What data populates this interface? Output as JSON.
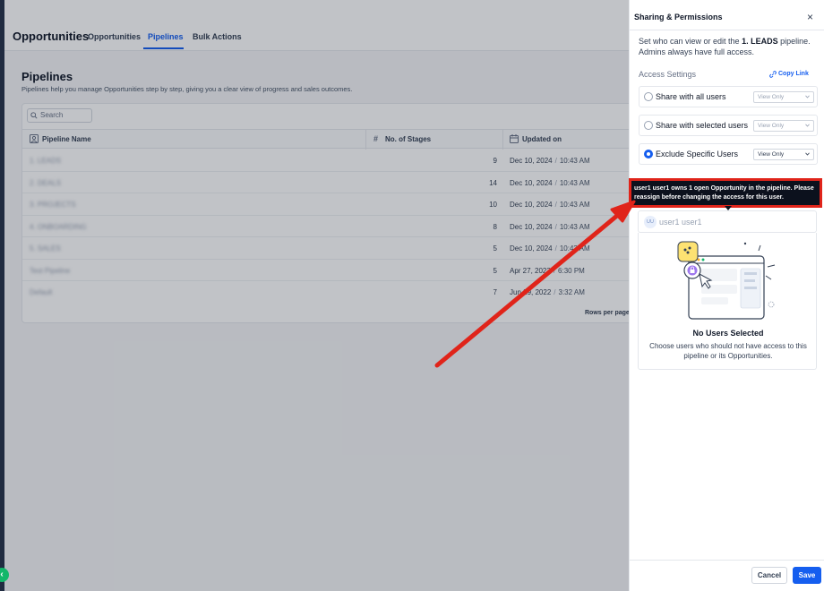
{
  "app": {
    "title": "Opportunities",
    "tabs": [
      "Opportunities",
      "Pipelines",
      "Bulk Actions"
    ],
    "active_tab": "Pipelines"
  },
  "page": {
    "title": "Pipelines",
    "subtitle": "Pipelines help you manage Opportunities step by step, giving you a clear view of progress and sales outcomes."
  },
  "table": {
    "search_placeholder": "Search",
    "columns": [
      "Pipeline Name",
      "No. of Stages",
      "Updated on"
    ],
    "rows": [
      {
        "name": "1. LEADS",
        "stages": "9",
        "date": "Dec 10, 2024",
        "time": "10:43 AM"
      },
      {
        "name": "2. DEALS",
        "stages": "14",
        "date": "Dec 10, 2024",
        "time": "10:43 AM"
      },
      {
        "name": "3. PROJECTS",
        "stages": "10",
        "date": "Dec 10, 2024",
        "time": "10:43 AM"
      },
      {
        "name": "4. ONBOARDING",
        "stages": "8",
        "date": "Dec 10, 2024",
        "time": "10:43 AM"
      },
      {
        "name": "5. SALES",
        "stages": "5",
        "date": "Dec 10, 2024",
        "time": "10:43 AM"
      },
      {
        "name": "Test Pipeline",
        "stages": "5",
        "date": "Apr 27, 2023",
        "time": "6:30 PM"
      },
      {
        "name": "Default",
        "stages": "7",
        "date": "Jun 29, 2022",
        "time": "3:32 AM"
      }
    ],
    "rows_per_page_label": "Rows per page"
  },
  "drawer": {
    "title": "Sharing & Permissions",
    "close_glyph": "×",
    "desc_prefix": "Set who can view or edit the ",
    "pipeline_name": "1. LEADS",
    "desc_suffix": " pipeline. Admins always have full access.",
    "access_label": "Access Settings",
    "copy_link": "Copy Link",
    "options": [
      {
        "label": "Share with all users",
        "permission": "View Only",
        "selected": false
      },
      {
        "label": "Share with selected users",
        "permission": "View Only",
        "selected": false
      },
      {
        "label": "Exclude Specific Users",
        "permission": "View Only",
        "selected": true
      }
    ],
    "tooltip": "user1 user1 owns 1 open Opportunity in the pipeline. Please reassign before changing the access for this user.",
    "selected_user": {
      "initials": "UU",
      "name": "user1 user1"
    },
    "empty": {
      "title": "No Users Selected",
      "description": "Choose users who should not have access to this pipeline or its Opportunities."
    },
    "buttons": {
      "cancel": "Cancel",
      "save": "Save"
    }
  },
  "colors": {
    "accent": "#155eef",
    "annotation": "#e0241a",
    "tooltip_bg": "#0c111d"
  },
  "annotation": {
    "type": "red-arrow",
    "points_to": "tooltip"
  }
}
